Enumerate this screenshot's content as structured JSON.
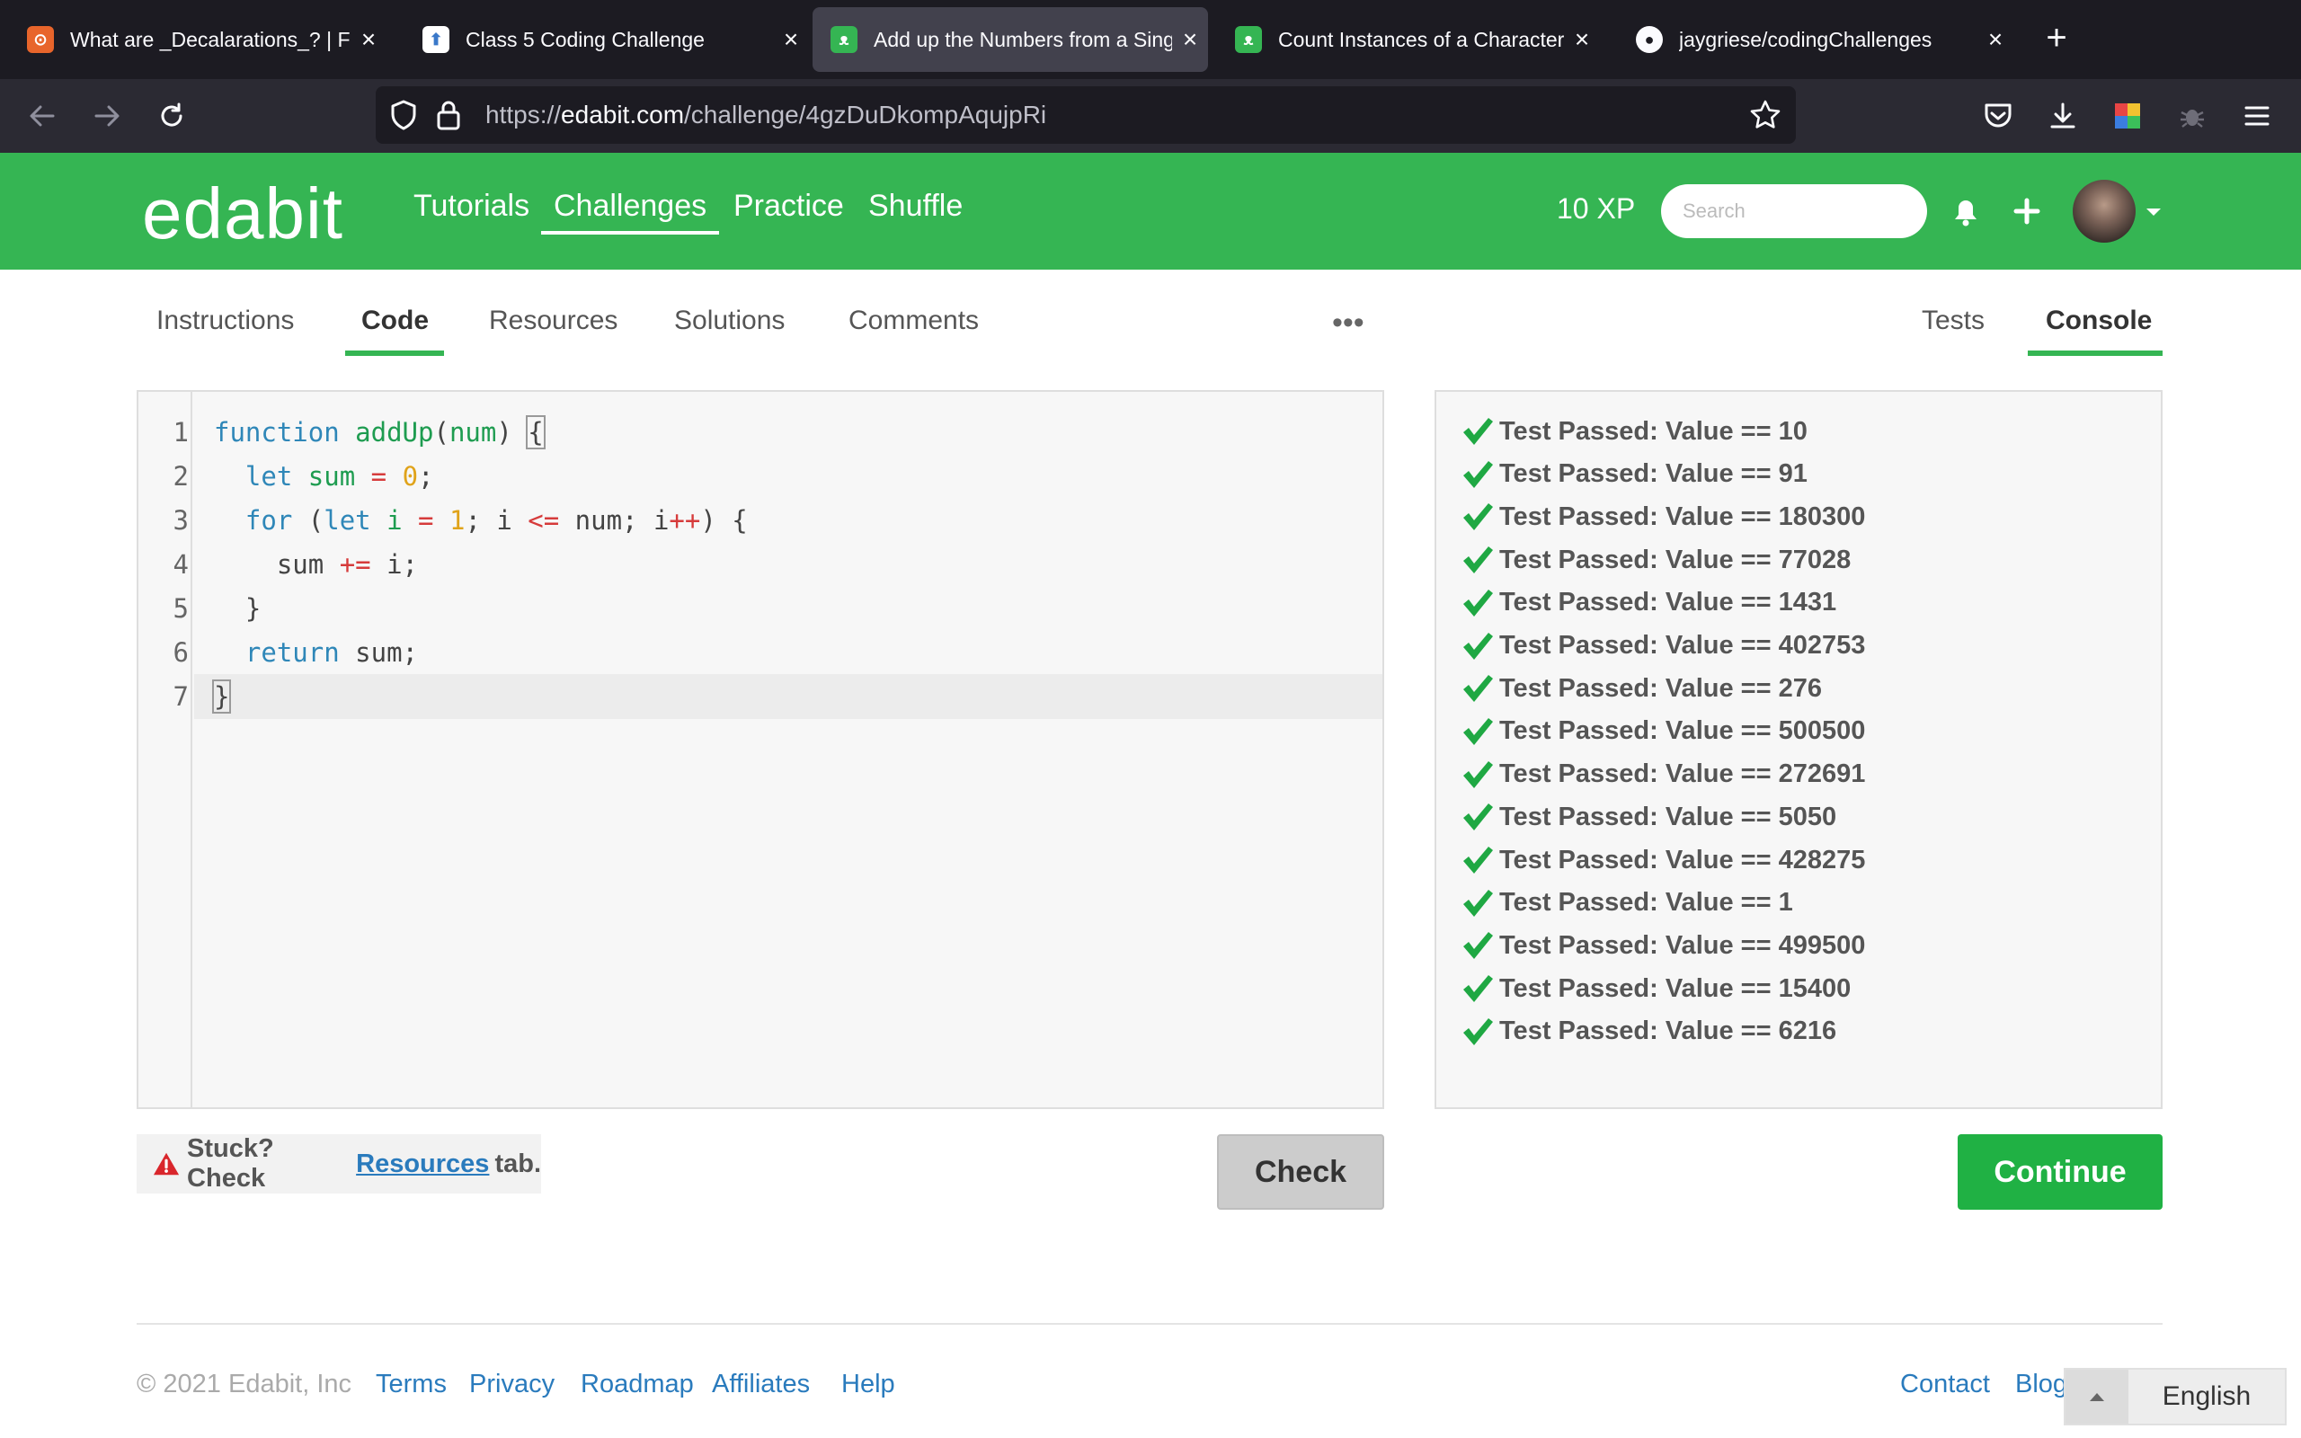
{
  "browser": {
    "tabs": [
      {
        "title": "What are _Decalarations_? | Full",
        "favicon": "orange-square-icon",
        "active": false
      },
      {
        "title": "Class 5 Coding Challenge",
        "favicon": "rocket-doc-icon",
        "active": false
      },
      {
        "title": "Add up the Numbers from a Sing",
        "favicon": "edabit-icon",
        "active": true
      },
      {
        "title": "Count Instances of a Character ii",
        "favicon": "edabit-icon",
        "active": false
      },
      {
        "title": "jaygriese/codingChallenges",
        "favicon": "github-icon",
        "active": false
      }
    ],
    "url": {
      "prefix": "https://",
      "host": "edabit.com",
      "path": "/challenge/4gzDuDkompAqujpRi"
    }
  },
  "header": {
    "logo": "edabit",
    "nav": [
      "Tutorials",
      "Challenges",
      "Practice",
      "Shuffle"
    ],
    "xp": "10 XP",
    "search_placeholder": "Search"
  },
  "subtabs": {
    "left": [
      "Instructions",
      "Code",
      "Resources",
      "Solutions",
      "Comments"
    ],
    "more": "•••",
    "right": [
      "Tests",
      "Console"
    ]
  },
  "editor": {
    "line_numbers": [
      "1",
      "2",
      "3",
      "4",
      "5",
      "6",
      "7"
    ]
  },
  "console": {
    "tests": [
      "Test Passed: Value == 10",
      "Test Passed: Value == 91",
      "Test Passed: Value == 180300",
      "Test Passed: Value == 77028",
      "Test Passed: Value == 1431",
      "Test Passed: Value == 402753",
      "Test Passed: Value == 276",
      "Test Passed: Value == 500500",
      "Test Passed: Value == 272691",
      "Test Passed: Value == 5050",
      "Test Passed: Value == 428275",
      "Test Passed: Value == 1",
      "Test Passed: Value == 499500",
      "Test Passed: Value == 15400",
      "Test Passed: Value == 6216"
    ]
  },
  "stuck": {
    "prefix": "Stuck? Check",
    "link": "Resources",
    "suffix": "tab."
  },
  "buttons": {
    "check": "Check",
    "continue": "Continue"
  },
  "footer": {
    "copyright": "© 2021 Edabit, Inc",
    "links_left": [
      "Terms",
      "Privacy",
      "Roadmap",
      "Affiliates",
      "Help"
    ],
    "links_right": [
      "Contact",
      "Blog"
    ],
    "language": "English"
  },
  "colors": {
    "brand_green": "#35b553",
    "continue_green": "#20b144",
    "link_blue": "#2a7bbd",
    "keyword_blue": "#2f87b8",
    "number_orange": "#e0a31a",
    "operator_red": "#d63b3b"
  }
}
